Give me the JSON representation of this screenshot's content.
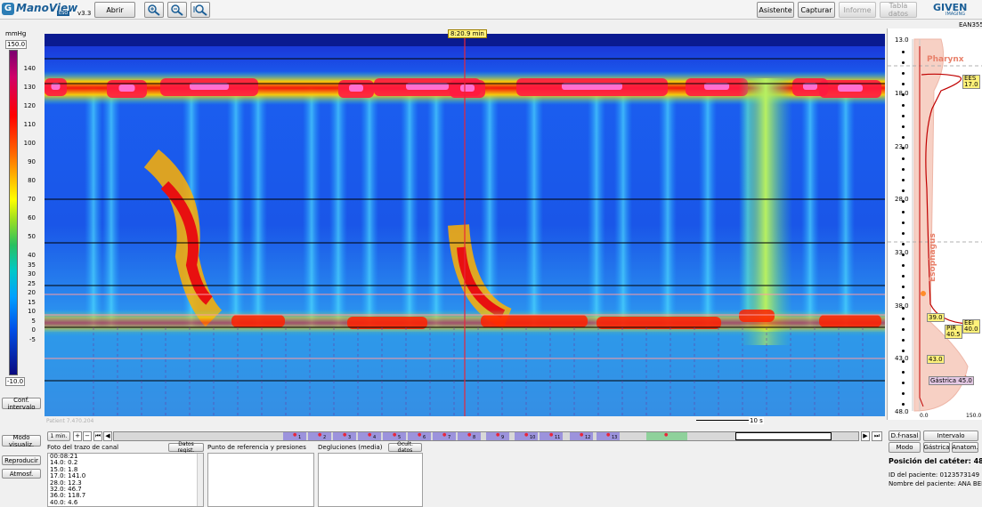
{
  "app": {
    "logo": "ManoView",
    "logo_badge": "ESO",
    "version": "v3.3",
    "brand": "GIVEN",
    "brand_sub": "IMAGING",
    "right_code": "EAN3557"
  },
  "toolbar": {
    "open": "Abrir",
    "assistant": "Asistente",
    "capture": "Capturar",
    "report": "Informe",
    "data_table": "Tabla datos"
  },
  "scale": {
    "unit": "mmHg",
    "top_value": "150.0",
    "bottom_value": "-10.0",
    "ticks": [
      "140",
      "130",
      "120",
      "110",
      "100",
      "90",
      "80",
      "70",
      "60",
      "50",
      "40",
      "35",
      "30",
      "25",
      "20",
      "15",
      "10",
      "5",
      "0",
      "-5"
    ],
    "config_button": "Conf. intervalo"
  },
  "plot": {
    "time_marker": "8:20.9 min",
    "patient_watermark": "Patient 7.470.204",
    "scale_bar_label": "10 s"
  },
  "anatomy": {
    "depth_labels": [
      "13.0",
      "18.0",
      "23.0",
      "28.0",
      "33.0",
      "38.0",
      "43.0",
      "48.0"
    ],
    "pharynx": "Pharynx",
    "esophagus": "Esophagus",
    "stomach_partial": "h",
    "ues_tag": "EES",
    "ues_value": "17.0",
    "tag_39": "39.0",
    "eei_tag": "EEI",
    "eei_value": "40.0",
    "pir_tag": "PIR",
    "pir_value": "40.5",
    "tag_43": "43.0",
    "gastric_tag": "Gástrica 45.0",
    "axis_min": "0.0",
    "axis_max": "150.0"
  },
  "timeline": {
    "zoom_label": "1 min.",
    "swallow_numbers": [
      "1",
      "2",
      "3",
      "4",
      "5",
      "6",
      "7",
      "8",
      "9",
      "10",
      "11",
      "12",
      "13"
    ]
  },
  "right_panel": {
    "df_nasal": "D.f-nasal",
    "interval": "Intervalo",
    "mode": "Modo",
    "gastric": "Gástrica",
    "anatomy": "Anatom.",
    "catheter_position": "Posición del catéter: 48.0 cm",
    "patient_id": "ID del paciente: 0123573149",
    "patient_name": "Nombre del paciente: ANA BENITE..."
  },
  "bottom": {
    "visual_mode": "Modo visualiz.",
    "play": "Reproducir",
    "atmos": "Atmosf.",
    "channel_snapshot_title": "Foto del trazo de canal",
    "register_data": "Datos regist.",
    "channel_values": [
      "00:08:21",
      "14.0: 0.2",
      "15.0: 1.8",
      "17.0: 141.0",
      "28.0: 12.3",
      "32.0: 46.7",
      "36.0: 118.7",
      "40.0: 4.6"
    ],
    "reference_title": "Punto de referencia y presiones",
    "swallows_title": "Degluciones (media)",
    "hide_data": "Ocult. datos"
  },
  "colors": {
    "band_purple": "#9c93dc",
    "band_green": "#8fd19b",
    "marker_red": "#e8263a",
    "highlight_yellow": "#fff27a"
  }
}
